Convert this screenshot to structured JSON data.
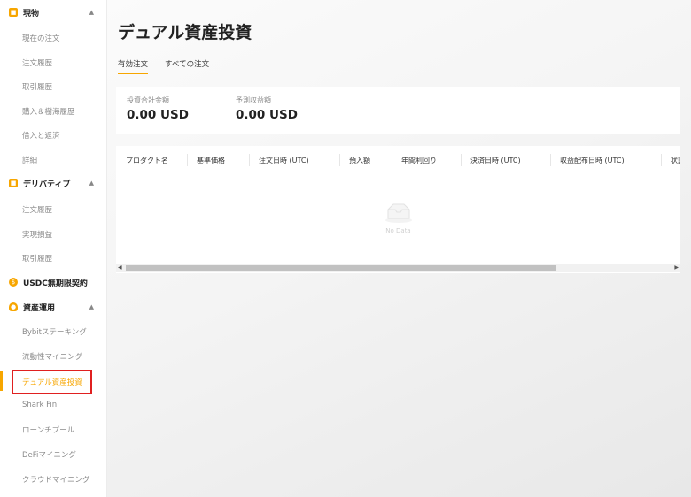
{
  "sidebar": {
    "sections": [
      {
        "label": "現物",
        "color": "#f7a600",
        "icon": "spot-icon",
        "chevron": "▲",
        "items": [
          "現在の注文",
          "注文履歴",
          "取引履歴",
          "購入＆樹海履歴",
          "借入と返済",
          "詳細"
        ]
      },
      {
        "label": "デリバティブ",
        "color": "#f7a600",
        "icon": "derivatives-icon",
        "chevron": "▲",
        "items": [
          "注文履歴",
          "実現損益",
          "取引履歴"
        ]
      },
      {
        "label": "USDC無期限契約",
        "color": "#f7a600",
        "icon": "usdc-icon",
        "chevron": "",
        "items": []
      },
      {
        "label": "資産運用",
        "color": "#f7a600",
        "icon": "earn-icon",
        "chevron": "▲",
        "items": [
          "Bybitステーキング",
          "流動性マイニング",
          "デュアル資産投資",
          "Shark Fin",
          "ローンチプール",
          "DeFiマイニング",
          "クラウドマイニング"
        ]
      }
    ],
    "active_item": "デュアル資産投資"
  },
  "main": {
    "title": "デュアル資産投資",
    "tabs": [
      "有効注文",
      "すべての注文"
    ],
    "active_tab": "有効注文",
    "summary": {
      "total_label": "投資合計金額",
      "total_value": "0.00 USD",
      "expected_label": "予測収益額",
      "expected_value": "0.00 USD"
    },
    "table": {
      "headers": [
        "プロダクト名",
        "基準価格",
        "注文日時 (UTC)",
        "預入額",
        "年間利回り",
        "決済日時 (UTC)",
        "収益配布日時 (UTC)",
        "状態"
      ],
      "empty_text": "No Data"
    }
  },
  "colors": {
    "accent": "#f7a600",
    "highlight": "#e02020"
  }
}
